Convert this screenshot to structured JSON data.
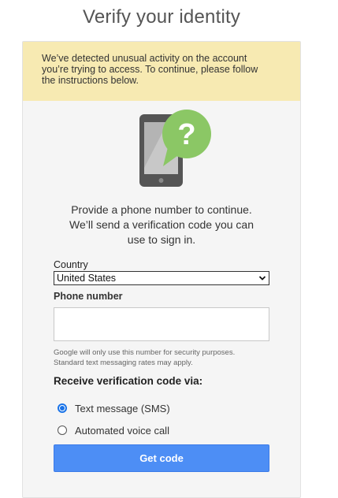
{
  "page": {
    "title": "Verify your identity"
  },
  "warning": {
    "line1": "We’ve detected unusual activity on the account",
    "line2": "you’re trying to access. To continue, please follow",
    "line3": "the instructions below."
  },
  "illustration": {
    "icon": "phone-question-icon",
    "symbol": "?"
  },
  "instruction": {
    "line1": "Provide a phone number to continue.",
    "line2": "We’ll send a verification code you can",
    "line3": "use to sign in."
  },
  "form": {
    "country_label": "Country",
    "country_value": "United States",
    "phone_label": "Phone number",
    "phone_value": "",
    "note_line1": "Google will only use this number for security purposes.",
    "note_line2": "Standard text messaging rates may apply.",
    "via_label": "Receive verification code via:",
    "options": [
      {
        "label": "Text message (SMS)",
        "selected": true
      },
      {
        "label": "Automated voice call",
        "selected": false
      }
    ],
    "submit_label": "Get code"
  },
  "colors": {
    "warning_bg": "#f7eab2",
    "card_bg": "#f5f5f5",
    "accent_green": "#8bc765",
    "button_blue": "#4d8ef5",
    "radio_blue": "#1a73e8"
  }
}
